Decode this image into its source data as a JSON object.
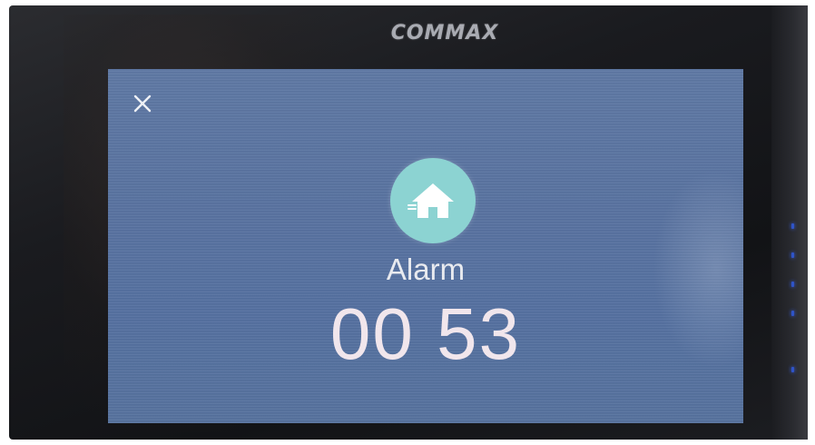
{
  "device": {
    "brand": "COMMAX"
  },
  "screen": {
    "close_icon": "close-icon",
    "status_icon": "home-icon",
    "status_icon_color": "#8cd3d2",
    "label": "Alarm",
    "timer": "00 53"
  },
  "colors": {
    "screen_bg": "#5a76a2",
    "text": "#f1e6ec",
    "indicator_led": "#2f54c8"
  }
}
